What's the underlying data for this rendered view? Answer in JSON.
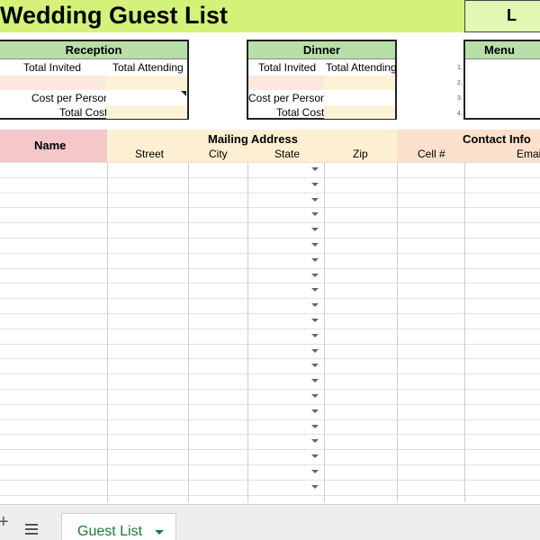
{
  "title": "Wedding Guest List",
  "title_right_fragment": "L",
  "reception": {
    "heading": "Reception",
    "total_invited": "Total Invited",
    "total_attending": "Total Attending",
    "cost_per_person": "Cost per Person",
    "total_cost": "Total Cost"
  },
  "dinner": {
    "heading": "Dinner",
    "total_invited": "Total Invited",
    "total_attending": "Total Attending",
    "cost_per_person": "Cost per Person",
    "total_cost": "Total Cost"
  },
  "menu": {
    "heading": "Menu",
    "numbers": [
      "1.",
      "2.",
      "3.",
      "4."
    ]
  },
  "table": {
    "name_header": "Name",
    "mailing_header": "Mailing Address",
    "contact_header": "Contact Info",
    "columns": [
      "Street",
      "City",
      "State",
      "Zip",
      "Cell #",
      "Email"
    ]
  },
  "sheet_tab": {
    "add_icon": "+",
    "label": "Guest List"
  },
  "colors": {
    "title_band": "#d4f279",
    "box_header": "#b9dfa8",
    "name_header": "#f4c7c9",
    "address_header": "#fdefd1",
    "contact_header": "#fbe0cb",
    "input_cell": "#fdf2d6",
    "tab_text": "#1b7a3a"
  }
}
